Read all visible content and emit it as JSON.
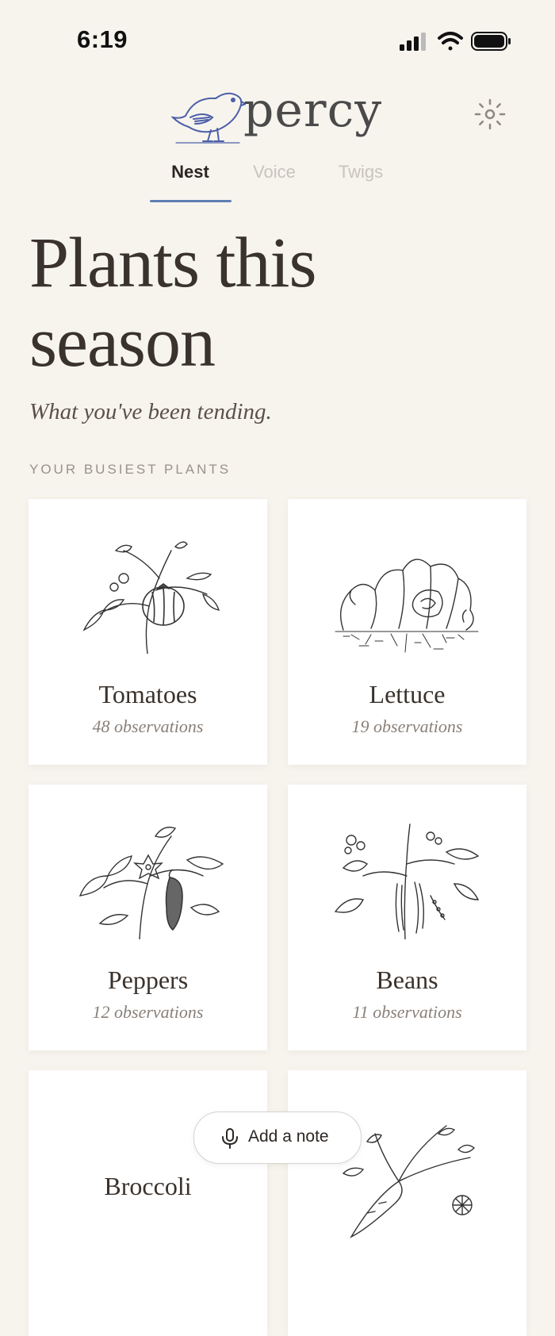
{
  "status_bar": {
    "time": "6:19",
    "icons": [
      "signal-icon",
      "wifi-icon",
      "battery-icon"
    ]
  },
  "header": {
    "logo_text": "percy",
    "settings_icon": "sun-gear-icon"
  },
  "tabs": [
    {
      "label": "Nest",
      "active": true
    },
    {
      "label": "Voice",
      "active": false
    },
    {
      "label": "Twigs",
      "active": false
    }
  ],
  "page": {
    "title_line1": "Plants this",
    "title_line2": "season",
    "subtitle": "What you've been tending.",
    "section_label": "YOUR BUSIEST PLANTS"
  },
  "plants": [
    {
      "name": "Tomatoes",
      "observations": "48 observations"
    },
    {
      "name": "Lettuce",
      "observations": "19 observations"
    },
    {
      "name": "Peppers",
      "observations": "12 observations"
    },
    {
      "name": "Beans",
      "observations": "11 observations"
    },
    {
      "name": "Broccoli",
      "observations": ""
    },
    {
      "name": "",
      "observations": ""
    }
  ],
  "add_note": {
    "label": "Add a note"
  },
  "colors": {
    "background": "#f7f4ee",
    "accent": "#5f7fb3",
    "text": "#3a322c",
    "muted": "#8a8079"
  }
}
